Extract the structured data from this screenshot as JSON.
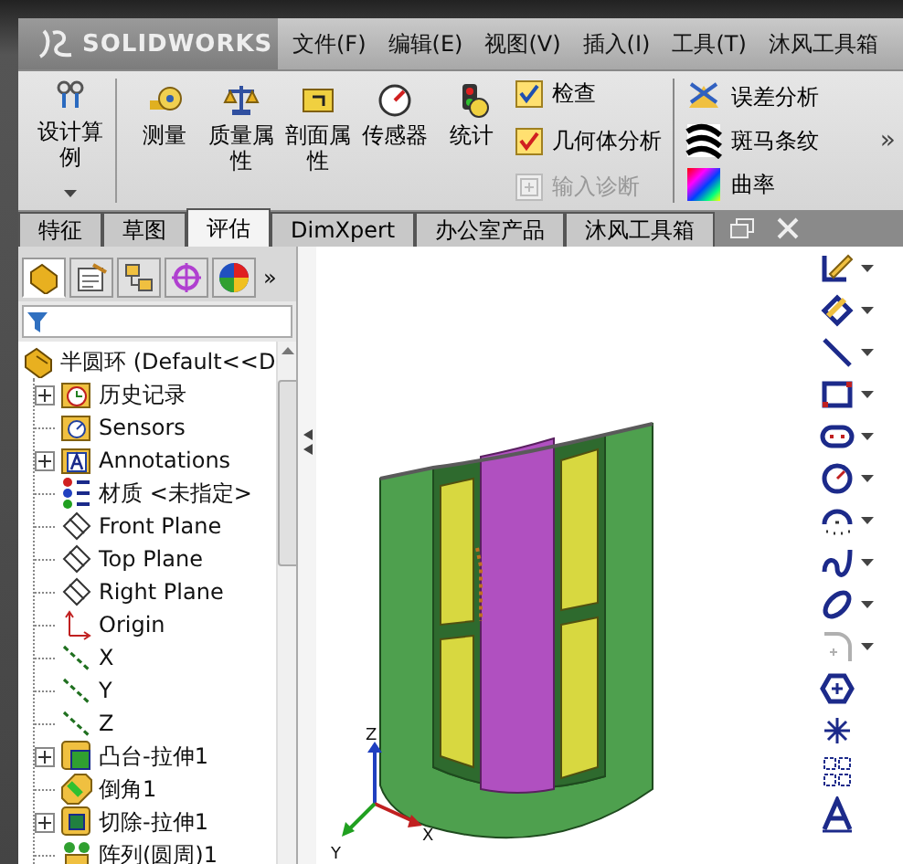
{
  "menubar": {
    "logo": "SOLIDWORKS",
    "menus": [
      "文件(F)",
      "编辑(E)",
      "视图(V)",
      "插入(I)",
      "工具(T)",
      "沐风工具箱"
    ]
  },
  "ribbon": {
    "big_buttons": [
      {
        "label": "设计算例",
        "kind": "study",
        "dropdown": true
      },
      {
        "label": "测量",
        "kind": "measure",
        "dropdown": false
      },
      {
        "label": "质量属性",
        "kind": "mass",
        "dropdown": false
      },
      {
        "label": "剖面属性",
        "kind": "section",
        "dropdown": false
      },
      {
        "label": "传感器",
        "kind": "sensor",
        "dropdown": false
      },
      {
        "label": "统计",
        "kind": "statistics",
        "dropdown": false
      }
    ],
    "check_tools": [
      {
        "label": "检查",
        "kind": "check",
        "disabled": false
      },
      {
        "label": "几何体分析",
        "kind": "check",
        "disabled": false
      },
      {
        "label": "输入诊断",
        "kind": "import",
        "disabled": true
      }
    ],
    "analysis_tools": [
      {
        "label": "误差分析",
        "kind": "deviation"
      },
      {
        "label": "斑马条纹",
        "kind": "zebra"
      },
      {
        "label": "曲率",
        "kind": "curvature"
      }
    ],
    "more": "»"
  },
  "tabs": [
    {
      "label": "特征",
      "selected": false
    },
    {
      "label": "草图",
      "selected": false
    },
    {
      "label": "评估",
      "selected": true
    },
    {
      "label": "DimXpert",
      "selected": false
    },
    {
      "label": "办公室产品",
      "selected": false
    },
    {
      "label": "沐风工具箱",
      "selected": false
    }
  ],
  "panel": {
    "tabs": [
      {
        "kind": "feature-tree",
        "selected": true
      },
      {
        "kind": "property",
        "selected": false
      },
      {
        "kind": "config",
        "selected": false
      },
      {
        "kind": "dimxpert",
        "selected": false
      },
      {
        "kind": "display",
        "selected": false
      }
    ],
    "more": "»",
    "tree": {
      "label": "半圆环  (Default<<D",
      "kind": "part",
      "children": [
        {
          "label": "历史记录",
          "kind": "history",
          "expandable": true
        },
        {
          "label": "Sensors",
          "kind": "sensors",
          "expandable": false
        },
        {
          "label": "Annotations",
          "kind": "annotations",
          "expandable": true
        },
        {
          "label": "材质 <未指定>",
          "kind": "material",
          "expandable": false
        },
        {
          "label": "Front Plane",
          "kind": "plane",
          "expandable": false
        },
        {
          "label": "Top Plane",
          "kind": "plane",
          "expandable": false
        },
        {
          "label": "Right Plane",
          "kind": "plane",
          "expandable": false
        },
        {
          "label": "Origin",
          "kind": "origin",
          "expandable": false
        },
        {
          "label": "X",
          "kind": "axis",
          "expandable": false
        },
        {
          "label": "Y",
          "kind": "axis",
          "expandable": false
        },
        {
          "label": "Z",
          "kind": "axis",
          "expandable": false
        },
        {
          "label": "凸台-拉伸1",
          "kind": "extrude",
          "expandable": true
        },
        {
          "label": "倒角1",
          "kind": "chamfer",
          "expandable": false
        },
        {
          "label": "切除-拉伸1",
          "kind": "cut",
          "expandable": true
        },
        {
          "label": "阵列(圆周)1",
          "kind": "pattern",
          "expandable": false
        }
      ]
    }
  },
  "triad": {
    "x": "X",
    "y": "Y",
    "z": "Z"
  },
  "sketch_toolbar": [
    {
      "kind": "sketch",
      "dropdown": true,
      "disabled": false
    },
    {
      "kind": "dimension",
      "dropdown": true,
      "disabled": false
    },
    {
      "kind": "line",
      "dropdown": true,
      "disabled": false
    },
    {
      "kind": "rectangle",
      "dropdown": true,
      "disabled": false
    },
    {
      "kind": "slot",
      "dropdown": true,
      "disabled": false
    },
    {
      "kind": "circle",
      "dropdown": true,
      "disabled": false
    },
    {
      "kind": "arc",
      "dropdown": true,
      "disabled": false
    },
    {
      "kind": "spline",
      "dropdown": true,
      "disabled": false
    },
    {
      "kind": "ellipse",
      "dropdown": true,
      "disabled": false
    },
    {
      "kind": "fillet",
      "dropdown": true,
      "disabled": true
    },
    {
      "kind": "polygon",
      "dropdown": false,
      "disabled": false
    },
    {
      "kind": "point",
      "dropdown": false,
      "disabled": false
    },
    {
      "kind": "pattern",
      "dropdown": false,
      "disabled": false
    },
    {
      "kind": "text",
      "dropdown": false,
      "disabled": false
    }
  ]
}
